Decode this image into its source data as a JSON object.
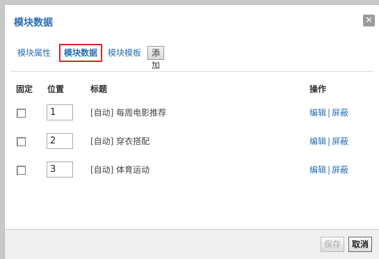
{
  "dialog": {
    "title": "模块数据"
  },
  "tabs": {
    "items": [
      {
        "label": "模块属性"
      },
      {
        "label": "模块数据"
      },
      {
        "label": "模块模板"
      }
    ],
    "add_label": "添加"
  },
  "table": {
    "headers": {
      "fixed": "固定",
      "position": "位置",
      "title": "标题",
      "actions": "操作"
    },
    "rows": [
      {
        "position": "1",
        "title": "[自动] 每周电影推荐",
        "edit": "编辑",
        "sep": "|",
        "block": "屏蔽"
      },
      {
        "position": "2",
        "title": "[自动] 穿衣搭配",
        "edit": "编辑",
        "sep": "|",
        "block": "屏蔽"
      },
      {
        "position": "3",
        "title": "[自动] 体育运动",
        "edit": "编辑",
        "sep": "|",
        "block": "屏蔽"
      }
    ]
  },
  "footer": {
    "save_label": "保存",
    "cancel_label": "取消"
  },
  "icons": {
    "close": "close-icon"
  },
  "colors": {
    "accent": "#2b6fb3",
    "active_border": "#dd2222"
  }
}
